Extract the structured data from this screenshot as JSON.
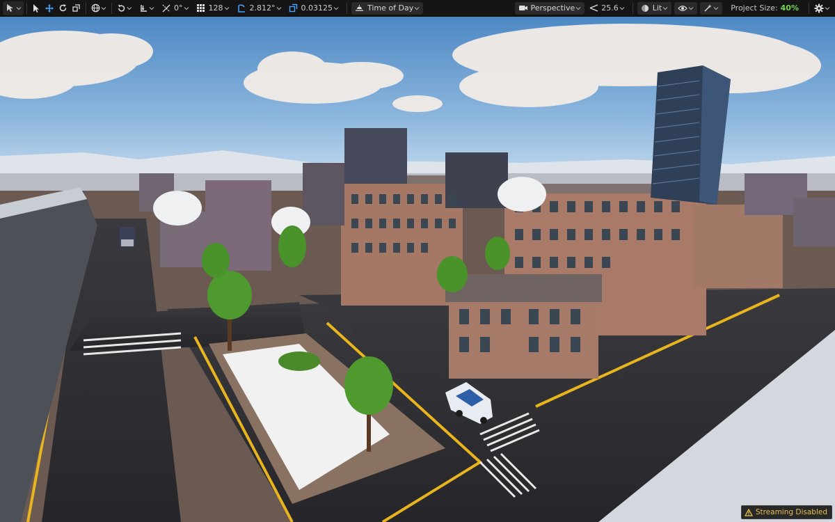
{
  "toolbar": {
    "grid_snap_value": "128",
    "rotation_snap_value": "2.812°",
    "scale_snap_value": "0.03125",
    "surface_snap_value": "0°",
    "time_of_day_label": "Time of Day",
    "view_mode_label": "Perspective",
    "fov_value": "25.6",
    "lit_label": "Lit",
    "project_size_label": "Project Size:",
    "project_size_value": "40%"
  },
  "status": {
    "streaming_label": "Streaming Disabled"
  },
  "colors": {
    "toolbar_bg": "#151515",
    "accent_blue": "#5aa7ff",
    "accent_green": "#6fd657",
    "warning": "#e8c04a"
  },
  "icons": [
    "select-mode-icon",
    "pointer-icon",
    "move-icon",
    "rotate-icon",
    "scale-icon",
    "world-icon",
    "refresh-icon",
    "surface-snap-icon",
    "angle-icon",
    "grid-icon",
    "rotation-snap-icon",
    "scale-snap-icon",
    "time-of-day-icon",
    "camera-icon",
    "fov-icon",
    "lit-icon",
    "eye-icon",
    "show-flags-icon",
    "settings-icon",
    "warning-icon"
  ]
}
